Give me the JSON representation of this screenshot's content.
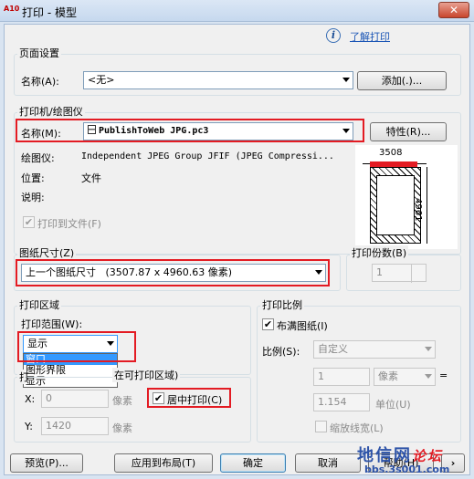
{
  "window": {
    "app_icon": "A10",
    "title": "打印 - 模型",
    "close_label": "✕"
  },
  "help": {
    "icon": "info-icon",
    "link": "了解打印"
  },
  "page_setup": {
    "group_label": "页面设置",
    "name_label": "名称(A):",
    "name_value": "<无>",
    "add_button": "添加(.)..."
  },
  "printer": {
    "group_label": "打印机/绘图仪",
    "name_label": "名称(M):",
    "name_value": "PublishToWeb JPG.pc3",
    "properties_button": "特性(R)...",
    "plotter_label": "绘图仪:",
    "plotter_value": "Independent JPEG Group JFIF (JPEG Compressi...",
    "location_label": "位置:",
    "location_value": "文件",
    "description_label": "说明:",
    "print_to_file_label": "打印到文件(F)",
    "print_to_file_checked": true,
    "preview_width": "3508",
    "preview_height": "4961"
  },
  "paper_size": {
    "group_label": "图纸尺寸(Z)",
    "value": "上一个图纸尺寸   (3507.87 x 4960.63 像素)"
  },
  "copies": {
    "group_label": "打印份数(B)",
    "value": "1"
  },
  "plot_area": {
    "group_label": "打印区域",
    "what_label": "打印范围(W):",
    "what_value": "显示",
    "dropdown_options": [
      "窗口",
      "图形界限",
      "显示"
    ],
    "dropdown_selected": "窗口"
  },
  "plot_offset": {
    "group_label_visible": "在可打印区域)",
    "x_label": "X:",
    "x_value": "0",
    "x_unit": "像素",
    "y_label": "Y:",
    "y_value": "1420",
    "y_unit": "像素",
    "center_label": "居中打印(C)",
    "center_checked": true
  },
  "plot_scale": {
    "group_label": "打印比例",
    "fit_label": "布满图纸(I)",
    "fit_checked": true,
    "scale_label": "比例(S):",
    "scale_value": "自定义",
    "value1": "1",
    "unit1": "像素",
    "value2": "1.154",
    "unit2": "单位(U)",
    "lineweights_label": "缩放线宽(L)",
    "lineweights_checked": false,
    "equals": "="
  },
  "buttons": {
    "preview": "预览(P)...",
    "apply": "应用到布局(T)",
    "ok": "确定",
    "cancel": "取消",
    "help": "帮助(H)",
    "expand_icon": "chevron-right-icon"
  },
  "watermark": {
    "title": "地信网",
    "subtitle": "论坛",
    "url": "bbs.3s001.com"
  },
  "colors": {
    "highlight": "#e31b23",
    "selection": "#3399ff",
    "dialog_bg": "#f0f0f0"
  }
}
